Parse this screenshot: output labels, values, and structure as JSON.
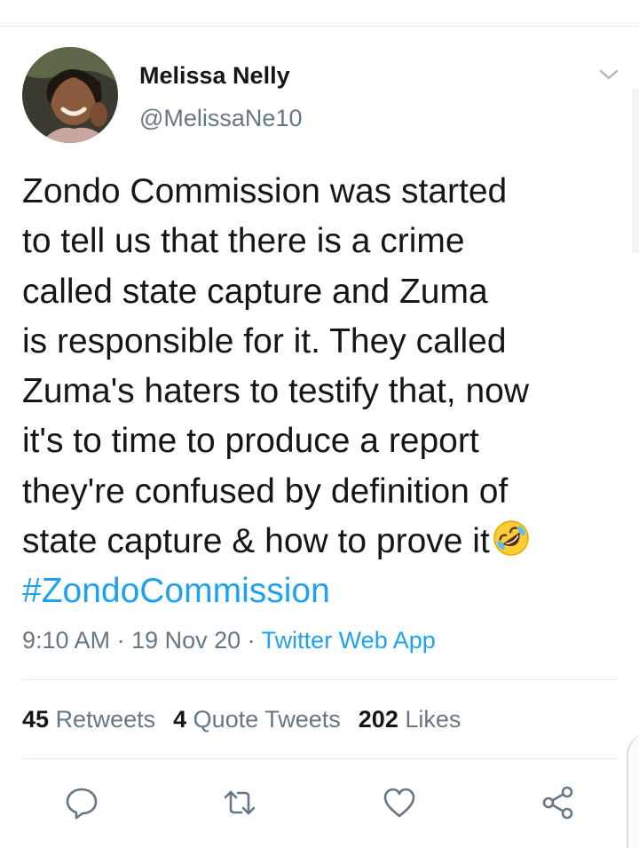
{
  "author": {
    "display_name": "Melissa Nelly",
    "handle": "@MelissaNe10",
    "avatar_icon": "profile-photo"
  },
  "tweet": {
    "lines": [
      "Zondo Commission was started",
      "to tell us that there is a crime",
      "called state capture and Zuma",
      "is responsible for it. They called",
      "Zuma's haters to testify that, now",
      "it's to time to produce a report",
      "they're confused by definition of",
      "state capture & how to prove it"
    ],
    "emoji_icon": "rolling-on-floor-laughing-emoji",
    "hashtag": "#ZondoCommission"
  },
  "meta": {
    "time": "9:10 AM",
    "separator": " · ",
    "date": "19 Nov 20",
    "source": "Twitter Web App"
  },
  "stats": {
    "retweets_count": "45",
    "retweets_label": "Retweets",
    "quotes_count": "4",
    "quotes_label": "Quote Tweets",
    "likes_count": "202",
    "likes_label": "Likes"
  },
  "actions": {
    "reply_icon": "reply-icon",
    "retweet_icon": "retweet-icon",
    "like_icon": "heart-icon",
    "share_icon": "share-icon"
  },
  "colors": {
    "link": "#1da1f2",
    "secondary_text": "#657786",
    "primary_text": "#14171a",
    "divider": "#e1e8ed"
  }
}
